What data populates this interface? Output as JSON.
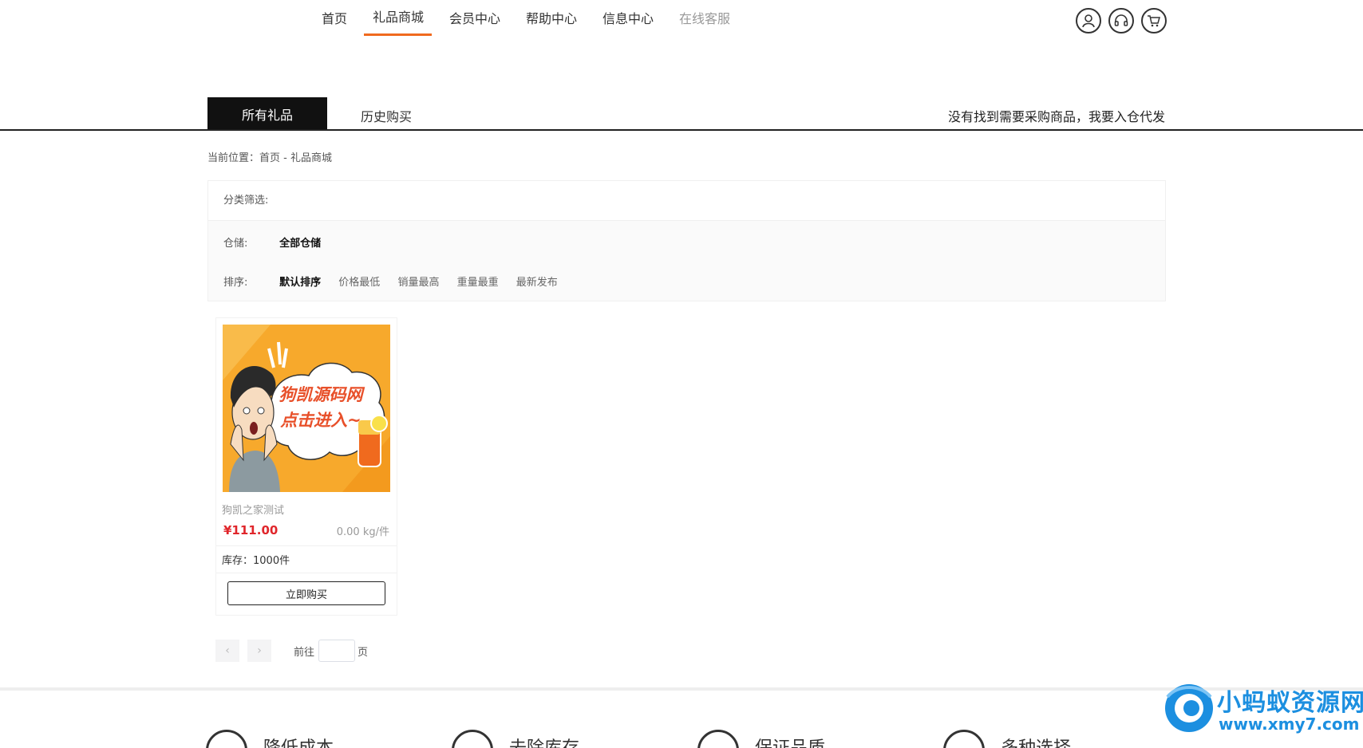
{
  "nav": {
    "items": [
      {
        "label": "首页"
      },
      {
        "label": "礼品商城"
      },
      {
        "label": "会员中心"
      },
      {
        "label": "帮助中心"
      },
      {
        "label": "信息中心"
      },
      {
        "label": "在线客服"
      }
    ],
    "active_index": 1,
    "icons": [
      "user-icon",
      "headset-icon",
      "cart-icon"
    ],
    "accent_color": "#f06a1e"
  },
  "tabs": {
    "active": "所有礼品",
    "other": "历史购买",
    "right_link": "没有找到需要采购商品，我要入仓代发"
  },
  "breadcrumb": "当前位置：首页 - 礼品商城",
  "filter": {
    "heading": "分类筛选:",
    "warehouse_label": "仓储:",
    "warehouse_options": [
      "全部仓储"
    ],
    "sort_label": "排序:",
    "sort_options": [
      "默认排序",
      "价格最低",
      "销量最高",
      "重量最重",
      "最新发布"
    ]
  },
  "product": {
    "image_text_line1": "狗凯源码网",
    "image_text_line2": "点击进入~",
    "name": "狗凯之家测试",
    "price": "¥111.00",
    "weight": "0.00 kg/件",
    "stock": "库存：1000件",
    "buy_label": "立即购买",
    "price_color": "#e0262b"
  },
  "pagination": {
    "prev": "‹",
    "next": "›",
    "goto_label": "前往",
    "page_value": "",
    "page_suffix": "页"
  },
  "features": [
    "降低成本",
    "去除库存",
    "保证品质",
    "多种选择"
  ],
  "watermark": {
    "title": "小蚂蚁资源网",
    "url": "www.xmy7.com",
    "color": "#1c8fe0"
  }
}
